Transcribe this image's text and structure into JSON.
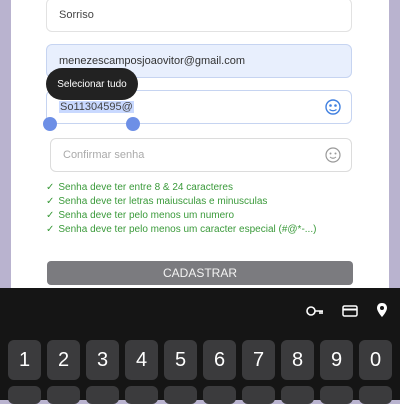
{
  "form": {
    "city_value": "Sorriso",
    "email_value": "menezescamposjoaovitor@gmail.com",
    "password_value": "So11304595@",
    "confirm_placeholder": "Confirmar senha",
    "tooltip_label": "Selecionar tudo",
    "rules": [
      "Senha deve ter entre 8 & 24 caracteres",
      "Senha deve ter letras maiusculas e minusculas",
      "Senha deve ter pelo menos um numero",
      "Senha deve ter pelo menos um caracter especial (#@*-...)"
    ],
    "submit_label": "CADASTRAR"
  },
  "colors": {
    "background": "#b9b3cf",
    "success": "#3a9a3a",
    "button": "#7b7b7f",
    "keyboard": "#151515"
  },
  "keyboard": {
    "keys": [
      "1",
      "2",
      "3",
      "4",
      "5",
      "6",
      "7",
      "8",
      "9",
      "0"
    ],
    "toolbar_icons": [
      "key-icon",
      "card-icon",
      "location-icon"
    ]
  }
}
